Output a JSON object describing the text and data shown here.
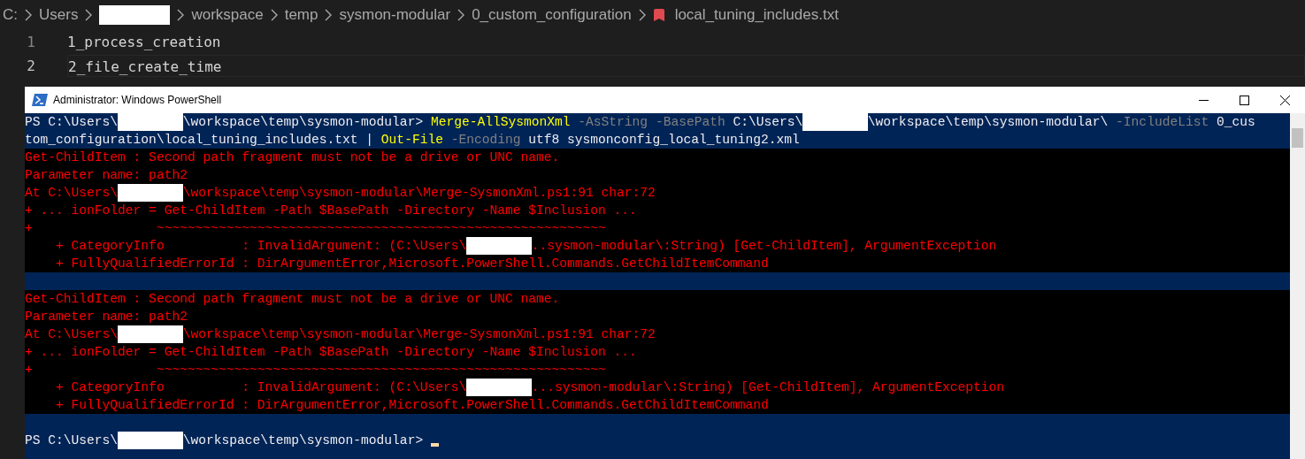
{
  "editor": {
    "breadcrumbs": [
      {
        "kind": "text",
        "label": "C:"
      },
      {
        "kind": "text",
        "label": "Users"
      },
      {
        "kind": "redacted"
      },
      {
        "kind": "text",
        "label": "workspace"
      },
      {
        "kind": "text",
        "label": "temp"
      },
      {
        "kind": "text",
        "label": "sysmon-modular"
      },
      {
        "kind": "text",
        "label": "0_custom_configuration"
      },
      {
        "kind": "file",
        "label": "local_tuning_includes.txt"
      }
    ],
    "lines": [
      {
        "number": "1",
        "text": "1_process_creation",
        "selected": false
      },
      {
        "number": "2",
        "text": "2_file_create_time",
        "selected": true
      }
    ]
  },
  "powershell": {
    "window": {
      "title": "Administrator: Windows PowerShell"
    },
    "lines": [
      {
        "kind": "prompt",
        "segments": [
          {
            "kind": "plain",
            "text": "PS C:\\Users\\"
          },
          {
            "kind": "redacted"
          },
          {
            "kind": "plain",
            "text": "\\workspace\\temp\\sysmon-modular> "
          },
          {
            "kind": "command",
            "text": "Merge-AllSysmonXml"
          },
          {
            "kind": "parameter",
            "text": " -AsString -BasePath"
          },
          {
            "kind": "plain",
            "text": " C:\\Users\\"
          },
          {
            "kind": "redacted"
          },
          {
            "kind": "plain",
            "text": "\\workspace\\temp\\sysmon-modular\\"
          },
          {
            "kind": "parameter",
            "text": " -IncludeList"
          },
          {
            "kind": "plain",
            "text": " 0_cus"
          }
        ]
      },
      {
        "kind": "prompt",
        "segments": [
          {
            "kind": "plain",
            "text": "tom_configuration\\local_tuning_includes.txt | "
          },
          {
            "kind": "command",
            "text": "Out-File"
          },
          {
            "kind": "parameter",
            "text": " -Encoding"
          },
          {
            "kind": "plain",
            "text": " utf8 sysmonconfig_local_tuning2.xml"
          }
        ]
      },
      {
        "kind": "error",
        "segments": [
          {
            "kind": "error",
            "text": "Get-ChildItem : Second path fragment must not be a drive or UNC name."
          }
        ]
      },
      {
        "kind": "error",
        "segments": [
          {
            "kind": "error",
            "text": "Parameter name: path2"
          }
        ]
      },
      {
        "kind": "error",
        "segments": [
          {
            "kind": "error",
            "text": "At C:\\Users\\"
          },
          {
            "kind": "redacted"
          },
          {
            "kind": "error",
            "text": "\\workspace\\temp\\sysmon-modular\\Merge-SysmonXml.ps1:91 char:72"
          }
        ]
      },
      {
        "kind": "error",
        "segments": [
          {
            "kind": "error",
            "text": "+ ... ionFolder = Get-ChildItem -Path $BasePath -Directory -Name $Inclusion ..."
          }
        ]
      },
      {
        "kind": "error",
        "segments": [
          {
            "kind": "error",
            "text": "+                ~~~~~~~~~~~~~~~~~~~~~~~~~~~~~~~~~~~~~~~~~~~~~~~~~~~~~~~~~~"
          }
        ]
      },
      {
        "kind": "error",
        "segments": [
          {
            "kind": "error",
            "text": "    + CategoryInfo          : InvalidArgument: (C:\\Users\\"
          },
          {
            "kind": "redacted"
          },
          {
            "kind": "error",
            "text": "..sysmon-modular\\:String) [Get-ChildItem], ArgumentException"
          }
        ]
      },
      {
        "kind": "error",
        "segments": [
          {
            "kind": "error",
            "text": "    + FullyQualifiedErrorId : DirArgumentError,Microsoft.PowerShell.Commands.GetChildItemCommand"
          }
        ]
      },
      {
        "kind": "blank"
      },
      {
        "kind": "error",
        "segments": [
          {
            "kind": "error",
            "text": "Get-ChildItem : Second path fragment must not be a drive or UNC name."
          }
        ]
      },
      {
        "kind": "error",
        "segments": [
          {
            "kind": "error",
            "text": "Parameter name: path2"
          }
        ]
      },
      {
        "kind": "error",
        "segments": [
          {
            "kind": "error",
            "text": "At C:\\Users\\"
          },
          {
            "kind": "redacted"
          },
          {
            "kind": "error",
            "text": "\\workspace\\temp\\sysmon-modular\\Merge-SysmonXml.ps1:91 char:72"
          }
        ]
      },
      {
        "kind": "error",
        "segments": [
          {
            "kind": "error",
            "text": "+ ... ionFolder = Get-ChildItem -Path $BasePath -Directory -Name $Inclusion ..."
          }
        ]
      },
      {
        "kind": "error",
        "segments": [
          {
            "kind": "error",
            "text": "+                ~~~~~~~~~~~~~~~~~~~~~~~~~~~~~~~~~~~~~~~~~~~~~~~~~~~~~~~~~~"
          }
        ]
      },
      {
        "kind": "error",
        "segments": [
          {
            "kind": "error",
            "text": "    + CategoryInfo          : InvalidArgument: (C:\\Users\\"
          },
          {
            "kind": "redacted"
          },
          {
            "kind": "error",
            "text": "...sysmon-modular\\:String) [Get-ChildItem], ArgumentException"
          }
        ]
      },
      {
        "kind": "error",
        "segments": [
          {
            "kind": "error",
            "text": "    + FullyQualifiedErrorId : DirArgumentError,Microsoft.PowerShell.Commands.GetChildItemCommand"
          }
        ]
      },
      {
        "kind": "blank"
      },
      {
        "kind": "prompt",
        "segments": [
          {
            "kind": "plain",
            "text": "PS C:\\Users\\"
          },
          {
            "kind": "redacted"
          },
          {
            "kind": "plain",
            "text": "\\workspace\\temp\\sysmon-modular> "
          },
          {
            "kind": "cursor"
          }
        ]
      }
    ]
  }
}
